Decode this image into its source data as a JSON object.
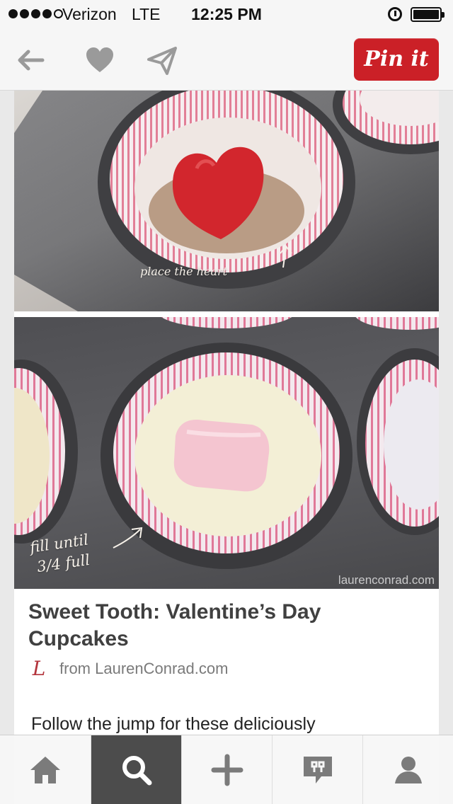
{
  "status_bar": {
    "carrier": "Verizon",
    "network": "LTE",
    "time": "12:25 PM"
  },
  "nav": {
    "pin_label": "Pin it",
    "pin_color": "#cb2027"
  },
  "pin": {
    "images": {
      "top_caption": "place the heart",
      "bottom_caption_line1": "fill until",
      "bottom_caption_line2": "3/4 full",
      "watermark": "laurenconrad.com"
    },
    "title": "Sweet Tooth: Valentine’s Day Cupcakes",
    "source": "from LaurenConrad.com",
    "source_icon": "L",
    "description": "Follow the jump for these deliciously"
  },
  "tabbar": {
    "tabs": [
      {
        "name": "home",
        "icon": "home-icon",
        "active": false
      },
      {
        "name": "search",
        "icon": "search-icon",
        "active": true
      },
      {
        "name": "add",
        "icon": "plus-icon",
        "active": false
      },
      {
        "name": "news",
        "icon": "news-icon",
        "active": false
      },
      {
        "name": "profile",
        "icon": "profile-icon",
        "active": false
      }
    ],
    "active_color": "#4c4c4c"
  }
}
